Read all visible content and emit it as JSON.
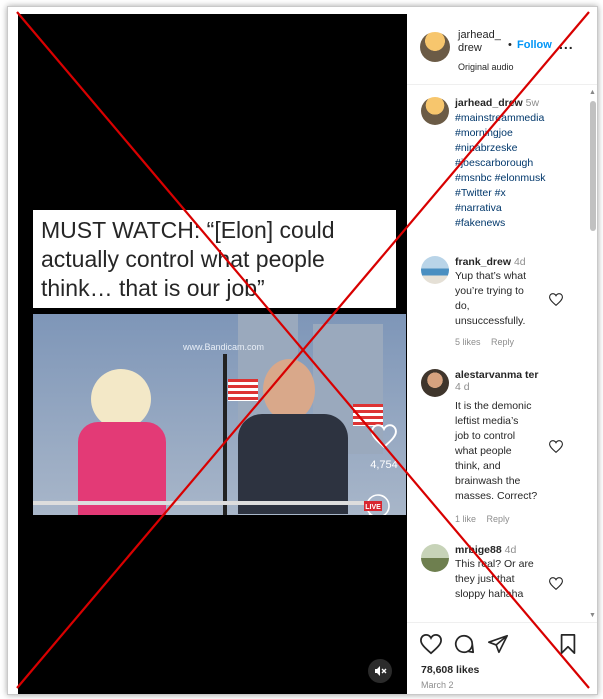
{
  "video": {
    "caption_lines": [
      "MUST WATCH: “[Elon] could",
      "actually control what people",
      "think… that is our job”"
    ],
    "watermark": "www.Bandicam.com",
    "like_count": "4,754",
    "live_label": "LIVE"
  },
  "post_header": {
    "username": "jarhead_ drew",
    "dot": "•",
    "follow_label": "Follow",
    "more_label": "...",
    "audio_label": "Original audio"
  },
  "comments": [
    {
      "username": "jarhead_drew",
      "time": "5w",
      "tags": [
        "#mainstreammedia",
        "#morningjoe",
        "#ninabrzeske",
        "#joescarborough",
        "#msnbc #elonmusk",
        "#Twitter #x",
        "#narrativa",
        "#fakenews"
      ]
    },
    {
      "username": "frank_drew",
      "time": "4d",
      "text_lines": [
        "Yup that’s what",
        "you’re trying to",
        "do,",
        "unsuccessfully."
      ],
      "likes": "5 likes",
      "reply": "Reply"
    },
    {
      "username": "alestarvanma ter",
      "time": "4 d",
      "text_lines": [
        "It is the demonic",
        "leftist media’s",
        "job to control",
        "what people",
        "think, and",
        "brainwash the",
        "masses. Correct?"
      ],
      "likes": "1 like",
      "reply": "Reply"
    },
    {
      "username": "mrbige88",
      "time": "4d",
      "text_lines": [
        "This real? Or are",
        "they just that",
        "sloppy hahaha"
      ]
    }
  ],
  "footer": {
    "likes_total": "78,608 likes",
    "date": "March 2"
  },
  "colors": {
    "accent": "#0095f6",
    "hashtag": "#00376b",
    "x_mark": "#d80000"
  }
}
